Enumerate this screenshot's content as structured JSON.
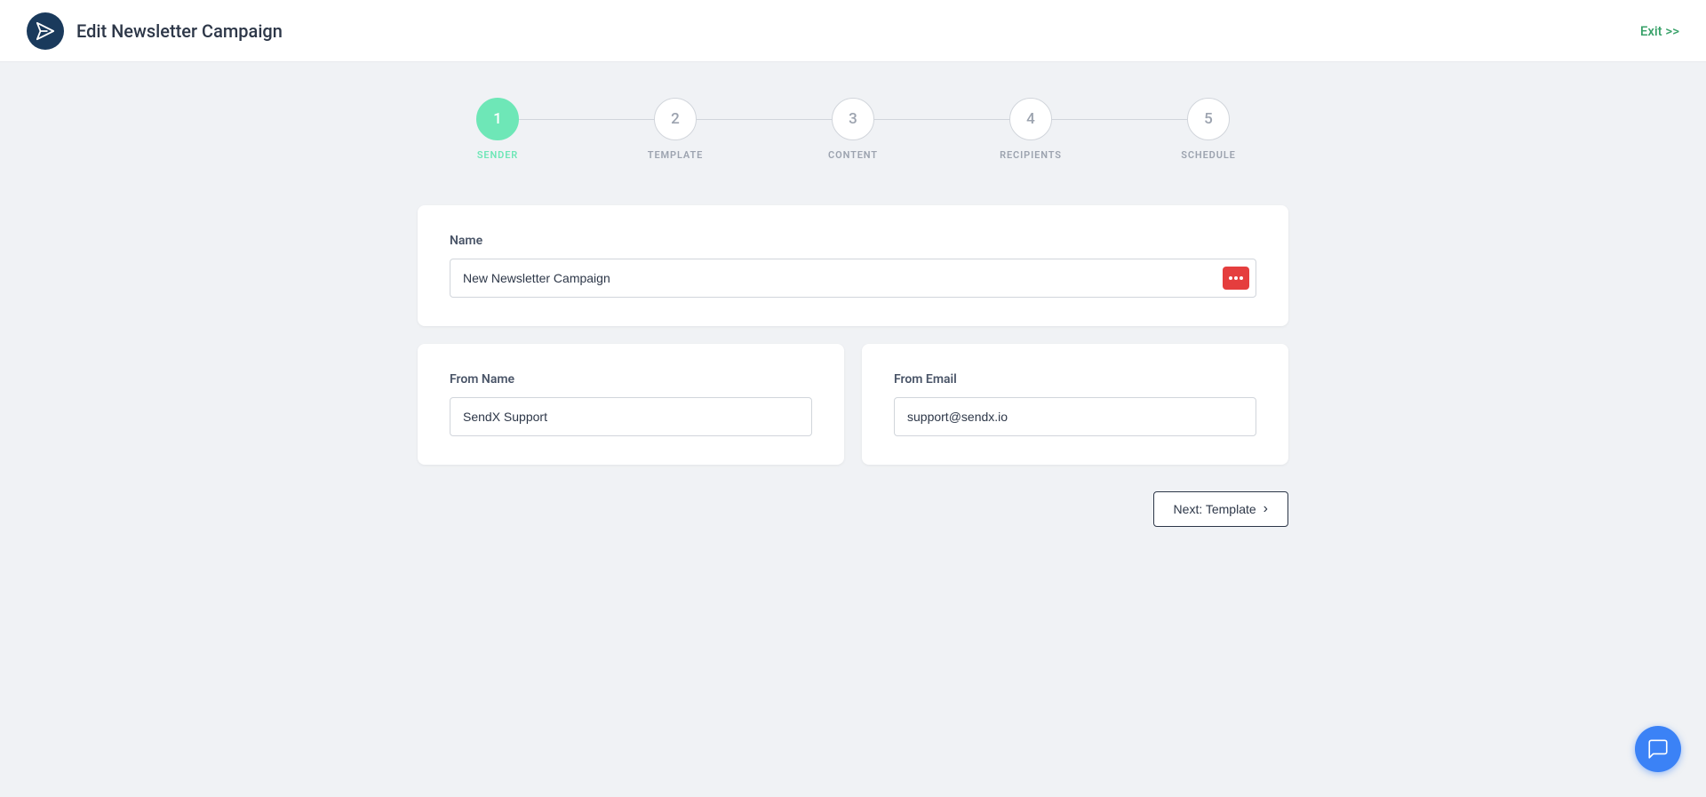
{
  "header": {
    "title": "Edit Newsletter Campaign",
    "exit_label": "Exit >>"
  },
  "stepper": {
    "steps": [
      {
        "number": "1",
        "label": "SENDER",
        "active": true
      },
      {
        "number": "2",
        "label": "TEMPLATE",
        "active": false
      },
      {
        "number": "3",
        "label": "CONTENT",
        "active": false
      },
      {
        "number": "4",
        "label": "RECIPIENTS",
        "active": false
      },
      {
        "number": "5",
        "label": "SCHEDULE",
        "active": false
      }
    ]
  },
  "form": {
    "name_label": "Name",
    "name_value": "New Newsletter Campaign",
    "name_placeholder": "New Newsletter Campaign",
    "from_name_label": "From Name",
    "from_name_value": "SendX Support",
    "from_name_placeholder": "SendX Support",
    "from_email_label": "From Email",
    "from_email_value": "support@sendx.io",
    "from_email_placeholder": "support@sendx.io"
  },
  "next_button": {
    "label": "Next: Template"
  }
}
